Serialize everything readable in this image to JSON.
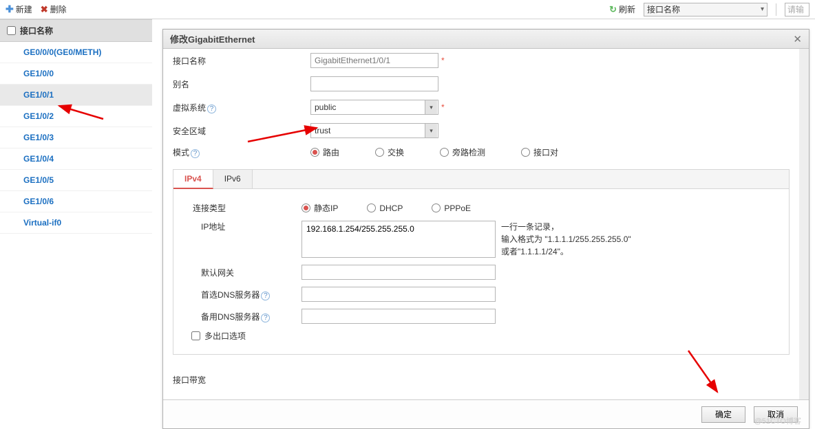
{
  "toolbar": {
    "new_label": "新建",
    "delete_label": "删除",
    "refresh_label": "刷新",
    "filter_field": "接口名称",
    "search_placeholder": "请输入"
  },
  "sidebar": {
    "header": "接口名称",
    "items": [
      {
        "label": "GE0/0/0(GE0/METH)"
      },
      {
        "label": "GE1/0/0"
      },
      {
        "label": "GE1/0/1",
        "selected": true
      },
      {
        "label": "GE1/0/2"
      },
      {
        "label": "GE1/0/3"
      },
      {
        "label": "GE1/0/4"
      },
      {
        "label": "GE1/0/5"
      },
      {
        "label": "GE1/0/6"
      },
      {
        "label": "Virtual-if0"
      }
    ]
  },
  "dialog": {
    "title": "修改GigabitEthernet",
    "labels": {
      "if_name": "接口名称",
      "alias": "别名",
      "vsys": "虚拟系统",
      "zone": "安全区域",
      "mode": "模式",
      "conn_type": "连接类型",
      "ip_addr": "IP地址",
      "gateway": "默认网关",
      "dns1": "首选DNS服务器",
      "dns2": "备用DNS服务器",
      "multi_export": "多出口选项",
      "bandwidth": "接口带宽"
    },
    "values": {
      "if_name": "GigabitEthernet1/0/1",
      "alias": "",
      "vsys": "public",
      "zone": "trust",
      "ip_addr": "192.168.1.254/255.255.255.0",
      "gateway": "",
      "dns1": "",
      "dns2": ""
    },
    "mode_options": {
      "route": "路由",
      "switch": "交换",
      "bypass": "旁路检测",
      "pair": "接口对"
    },
    "conn_options": {
      "static": "静态IP",
      "dhcp": "DHCP",
      "pppoe": "PPPoE"
    },
    "tabs": {
      "ipv4": "IPv4",
      "ipv6": "IPv6"
    },
    "ip_hint_line1": "一行一条记录，",
    "ip_hint_line2": "输入格式为 \"1.1.1.1/255.255.255.0\"",
    "ip_hint_line3": "或者\"1.1.1.1/24\"。",
    "buttons": {
      "ok": "确定",
      "cancel": "取消"
    }
  },
  "watermark": "@51CTO博客"
}
